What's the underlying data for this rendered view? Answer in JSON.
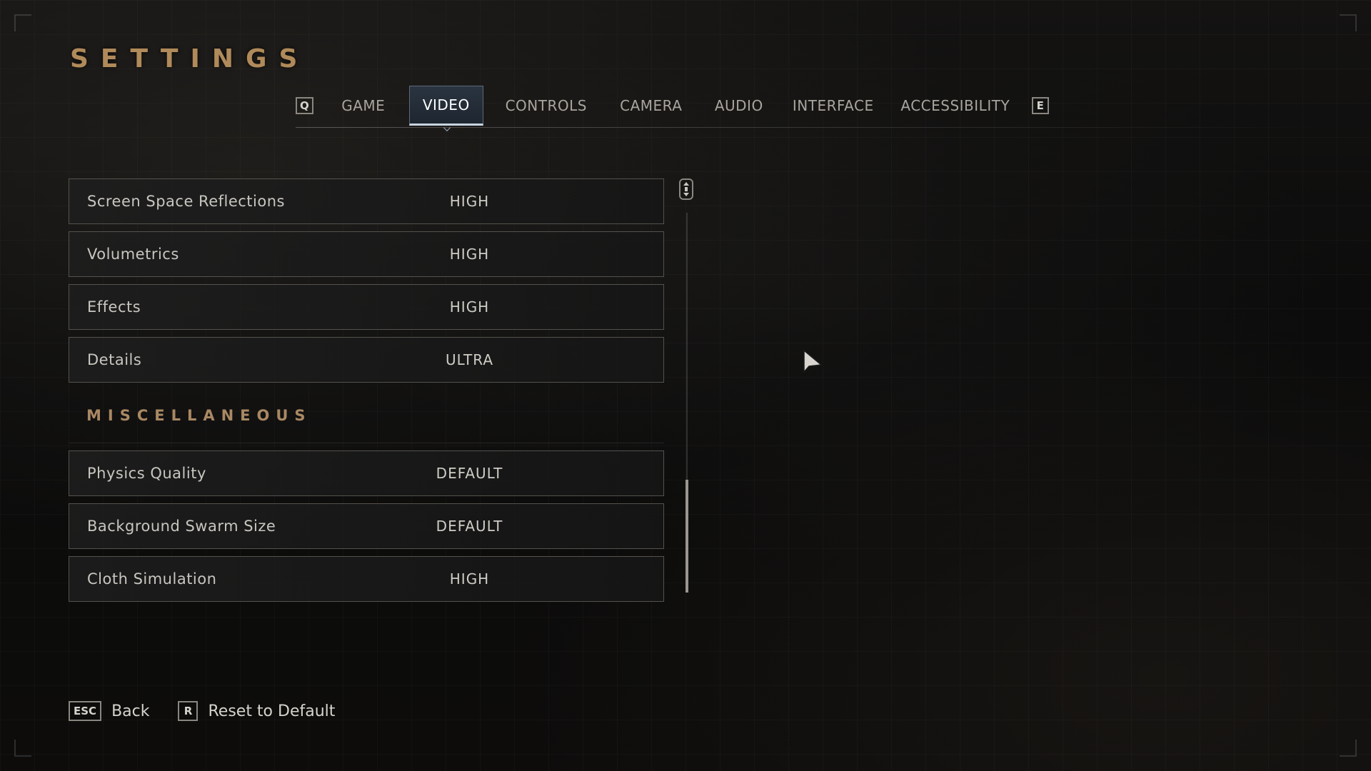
{
  "header": {
    "title": "SETTINGS"
  },
  "tabs": {
    "prev_key": "Q",
    "next_key": "E",
    "items": [
      {
        "label": "GAME"
      },
      {
        "label": "VIDEO",
        "active": true
      },
      {
        "label": "CONTROLS"
      },
      {
        "label": "CAMERA"
      },
      {
        "label": "AUDIO"
      },
      {
        "label": "INTERFACE"
      },
      {
        "label": "ACCESSIBILITY"
      }
    ]
  },
  "settings": {
    "rows": [
      {
        "label": "Screen Space Reflections",
        "value": "HIGH"
      },
      {
        "label": "Volumetrics",
        "value": "HIGH"
      },
      {
        "label": "Effects",
        "value": "HIGH"
      },
      {
        "label": "Details",
        "value": "ULTRA"
      }
    ],
    "misc_header": "MISCELLANEOUS",
    "misc_rows": [
      {
        "label": "Physics Quality",
        "value": "DEFAULT"
      },
      {
        "label": "Background Swarm Size",
        "value": "DEFAULT"
      },
      {
        "label": "Cloth Simulation",
        "value": "HIGH"
      }
    ]
  },
  "footer": {
    "back_key": "ESC",
    "back_label": "Back",
    "reset_key": "R",
    "reset_label": "Reset to Default"
  },
  "colors": {
    "accent_title": "#b08a5a",
    "active_tab_bg": "#1e2630"
  },
  "icons": {
    "scroll_handle": "scroll-updown-icon",
    "cursor": "mouse-cursor-icon"
  }
}
